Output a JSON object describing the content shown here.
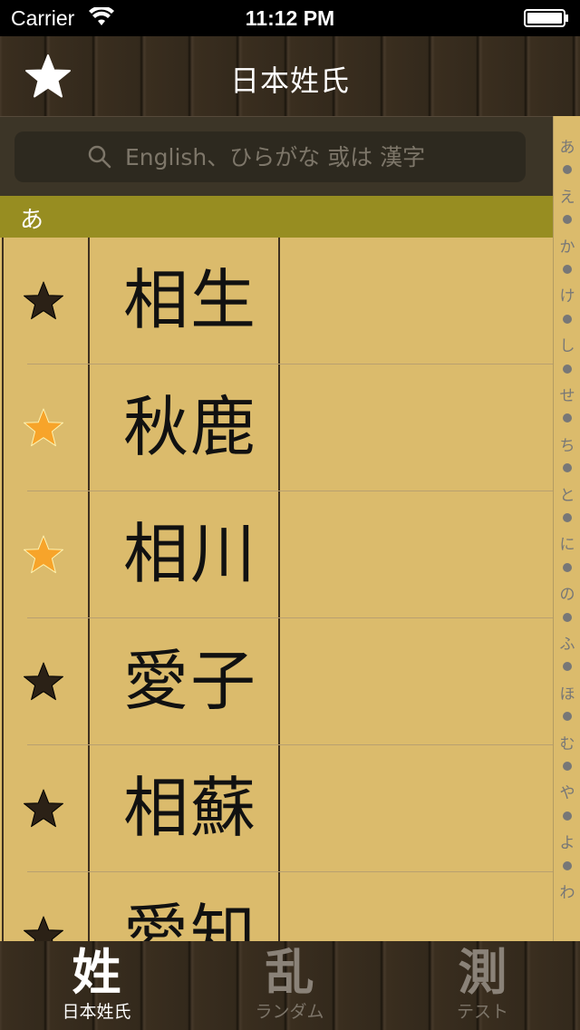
{
  "status_bar": {
    "carrier": "Carrier",
    "time": "11:12 PM"
  },
  "nav": {
    "title": "日本姓氏",
    "favorites_icon": "star-icon"
  },
  "search": {
    "placeholder": "English、ひらがな 或は 漢字",
    "value": ""
  },
  "section": {
    "label": "あ"
  },
  "rows": [
    {
      "name": "相生",
      "favorite": false
    },
    {
      "name": "秋鹿",
      "favorite": true
    },
    {
      "name": "相川",
      "favorite": true
    },
    {
      "name": "愛子",
      "favorite": false
    },
    {
      "name": "相蘇",
      "favorite": false
    },
    {
      "name": "愛知",
      "favorite": false
    }
  ],
  "index": [
    "あ",
    "え",
    "か",
    "け",
    "し",
    "せ",
    "ち",
    "と",
    "に",
    "の",
    "ふ",
    "ほ",
    "む",
    "や",
    "よ",
    "わ"
  ],
  "tabs": [
    {
      "glyph": "姓",
      "label": "日本姓氏",
      "active": true
    },
    {
      "glyph": "乱",
      "label": "ランダム",
      "active": false
    },
    {
      "glyph": "測",
      "label": "テスト",
      "active": false
    }
  ],
  "colors": {
    "list_background": "#dbbb6c",
    "section_header": "#978d21",
    "favorite_star": "#f7a42a",
    "normal_star": "#2b2116"
  }
}
